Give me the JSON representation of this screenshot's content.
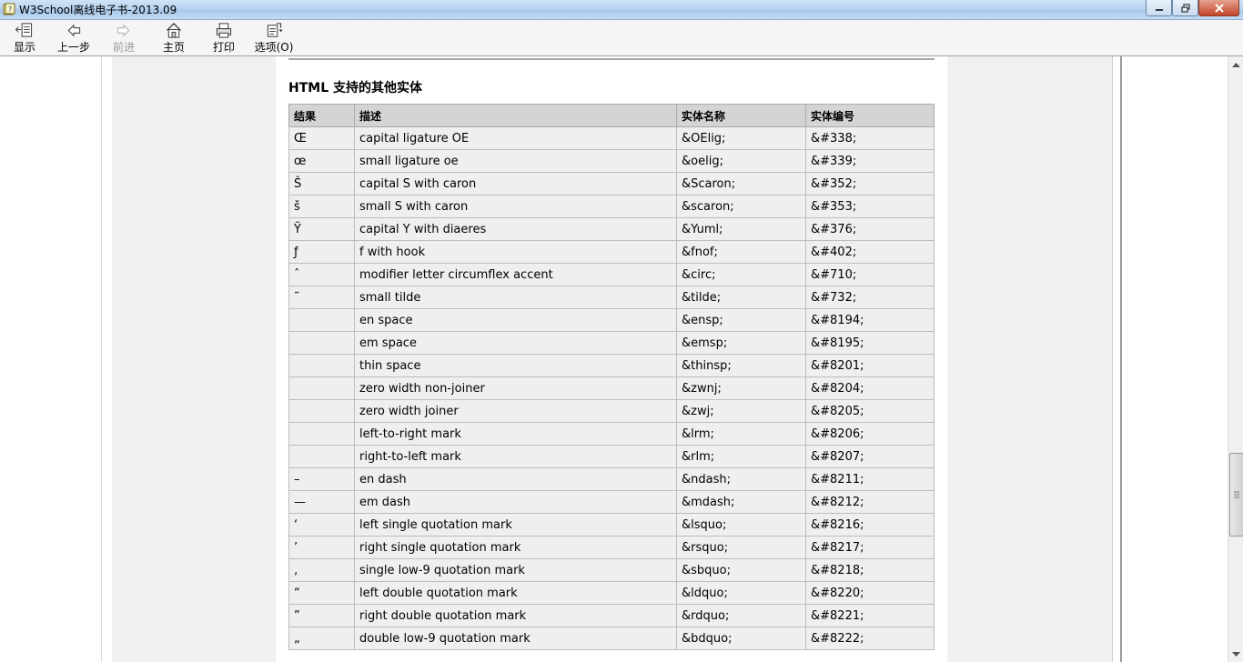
{
  "window": {
    "title": "W3School离线电子书-2013.09"
  },
  "toolbar": {
    "buttons": [
      {
        "label": "显示",
        "icon": "show-pane-icon"
      },
      {
        "label": "上一步",
        "icon": "back-arrow-icon"
      },
      {
        "label": "前进",
        "icon": "forward-arrow-icon",
        "disabled": true
      },
      {
        "label": "主页",
        "icon": "home-icon"
      },
      {
        "label": "打印",
        "icon": "print-icon"
      },
      {
        "label": "选项(O)",
        "icon": "options-icon"
      }
    ]
  },
  "page": {
    "section_title": "HTML 支持的其他实体",
    "table": {
      "headers": [
        "结果",
        "描述",
        "实体名称",
        "实体编号"
      ],
      "rows": [
        [
          "Œ",
          "capital ligature OE",
          "&OElig;",
          "&#338;"
        ],
        [
          "œ",
          "small ligature oe",
          "&oelig;",
          "&#339;"
        ],
        [
          "Š",
          "capital S with caron",
          "&Scaron;",
          "&#352;"
        ],
        [
          "š",
          "small S with caron",
          "&scaron;",
          "&#353;"
        ],
        [
          "Ÿ",
          "capital Y with diaeres",
          "&Yuml;",
          "&#376;"
        ],
        [
          "ƒ",
          "f with hook",
          "&fnof;",
          "&#402;"
        ],
        [
          "ˆ",
          "modifier letter circumflex accent",
          "&circ;",
          "&#710;"
        ],
        [
          "˜",
          "small tilde",
          "&tilde;",
          "&#732;"
        ],
        [
          "",
          "en space",
          "&ensp;",
          "&#8194;"
        ],
        [
          "",
          "em space",
          "&emsp;",
          "&#8195;"
        ],
        [
          "",
          "thin space",
          "&thinsp;",
          "&#8201;"
        ],
        [
          "",
          "zero width non-joiner",
          "&zwnj;",
          "&#8204;"
        ],
        [
          "",
          "zero width joiner",
          "&zwj;",
          "&#8205;"
        ],
        [
          "",
          "left-to-right mark",
          "&lrm;",
          "&#8206;"
        ],
        [
          "",
          "right-to-left mark",
          "&rlm;",
          "&#8207;"
        ],
        [
          "–",
          "en dash",
          "&ndash;",
          "&#8211;"
        ],
        [
          "—",
          "em dash",
          "&mdash;",
          "&#8212;"
        ],
        [
          "‘",
          "left single quotation mark",
          "&lsquo;",
          "&#8216;"
        ],
        [
          "’",
          "right single quotation mark",
          "&rsquo;",
          "&#8217;"
        ],
        [
          "‚",
          "single low-9 quotation mark",
          "&sbquo;",
          "&#8218;"
        ],
        [
          "“",
          "left double quotation mark",
          "&ldquo;",
          "&#8220;"
        ],
        [
          "”",
          "right double quotation mark",
          "&rdquo;",
          "&#8221;"
        ],
        [
          "„",
          "double low-9 quotation mark",
          "&bdquo;",
          "&#8222;"
        ]
      ]
    }
  }
}
